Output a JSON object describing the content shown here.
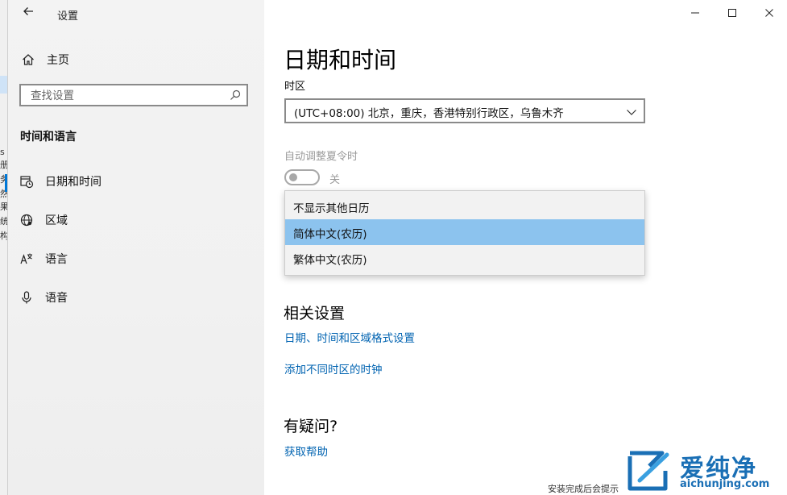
{
  "window": {
    "title": "设置"
  },
  "sidebar": {
    "home_label": "主页",
    "search_placeholder": "查找设置",
    "section_title": "时间和语言",
    "items": [
      {
        "label": "日期和时间",
        "icon": "calendar-clock-icon"
      },
      {
        "label": "区域",
        "icon": "globe-icon"
      },
      {
        "label": "语言",
        "icon": "language-icon"
      },
      {
        "label": "语音",
        "icon": "microphone-icon"
      }
    ]
  },
  "content": {
    "page_title": "日期和时间",
    "timezone": {
      "label": "时区",
      "value": "(UTC+08:00) 北京，重庆，香港特别行政区，乌鲁木齐"
    },
    "dst": {
      "label": "自动调整夏令时",
      "state": "关"
    },
    "calendar_dropdown": {
      "options": [
        "不显示其他日历",
        "简体中文(农历)",
        "繁体中文(农历)"
      ],
      "selected": "简体中文(农历)"
    },
    "related": {
      "title": "相关设置",
      "links": [
        "日期、时间和区域格式设置",
        "添加不同时区的时钟"
      ]
    },
    "help": {
      "title": "有疑问?",
      "link": "获取帮助"
    }
  },
  "background_window": {
    "snippets": [
      "s",
      "册",
      "务",
      "然",
      "果",
      "统",
      "构"
    ],
    "bottom_text": "安装完成后会提示"
  },
  "watermark": {
    "cn": "爱纯净",
    "en": "aichunjing.com"
  },
  "colors": {
    "accent": "#0078d7",
    "link": "#0063b1",
    "selected_option": "#8cc3ee",
    "sidebar_bg": "#f2f2f2",
    "disabled_text": "#9a9a9a"
  }
}
